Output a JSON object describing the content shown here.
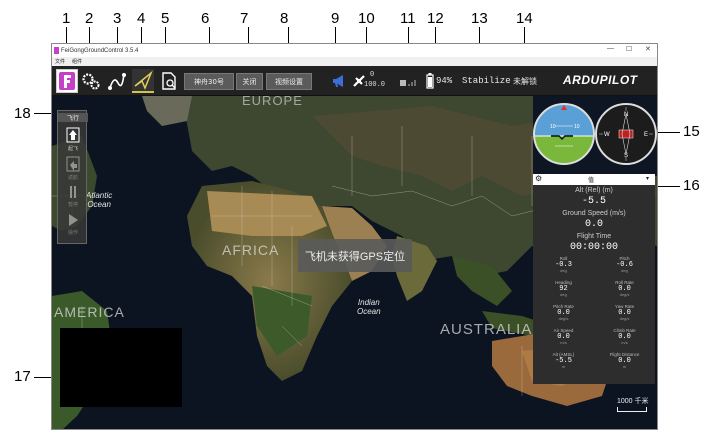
{
  "window": {
    "title": "FeiGongGroundControl 3.5.4",
    "controls": [
      "—",
      "☐",
      "✕"
    ]
  },
  "menu": [
    "文件",
    "组件"
  ],
  "toolbar": {
    "buttons": [
      "神舟30号",
      "关闭",
      "视频设置"
    ],
    "link_value": "0",
    "link_value2": "100.0",
    "battery": "94%",
    "mode": "Stabilize",
    "arm_status": "未解锁",
    "logo_text": "ARDUPILOT"
  },
  "map": {
    "labels": {
      "europe": "EUROPE",
      "atlantic": "Atlantic\nOcean",
      "africa": "AFRICA",
      "indian": "Indian\nOcean",
      "america": "AMERICA",
      "australia": "AUSTRALIA"
    },
    "gps_message": "飞机未获得GPS定位",
    "scale": "1000 千米"
  },
  "left_panel": {
    "title": "飞行",
    "items": [
      "起飞",
      "返航",
      "暂停",
      "操作"
    ]
  },
  "attitude_scale": [
    "10",
    "10"
  ],
  "compass_letters": [
    "N",
    "E",
    "S",
    "W"
  ],
  "values": {
    "dropdown": "值",
    "alt_rel_label": "Alt (Rel) (m)",
    "alt_rel_value": "-5.5",
    "ground_speed_label": "Ground Speed (m/s)",
    "ground_speed_value": "0.0",
    "flight_time_label": "Flight Time",
    "flight_time_value": "00:00:00",
    "cells": [
      {
        "label": "Roll",
        "value": "-0.3",
        "unit": "deg"
      },
      {
        "label": "Pitch",
        "value": "-0.6",
        "unit": "deg"
      },
      {
        "label": "Heading",
        "value": "92",
        "unit": "deg"
      },
      {
        "label": "Roll Rate",
        "value": "0.0",
        "unit": "deg/s"
      },
      {
        "label": "Pitch Rate",
        "value": "0.0",
        "unit": "deg/s"
      },
      {
        "label": "Yaw Rate",
        "value": "0.0",
        "unit": "deg/s"
      },
      {
        "label": "Air Speed",
        "value": "0.0",
        "unit": "m/s"
      },
      {
        "label": "Climb Rate",
        "value": "0.0",
        "unit": "m/s"
      },
      {
        "label": "Alt (AMSL)",
        "value": "-5.5",
        "unit": "m"
      },
      {
        "label": "Flight Distance",
        "value": "0.0",
        "unit": "m"
      }
    ]
  },
  "callouts": [
    "1",
    "2",
    "3",
    "4",
    "5",
    "6",
    "7",
    "8",
    "9",
    "10",
    "11",
    "12",
    "13",
    "14",
    "15",
    "16",
    "17",
    "18"
  ],
  "colors": {
    "accent": "#c63fc9",
    "sky": "#5aa0d6",
    "ground": "#7ab83c",
    "map_bg": "#0b1420"
  }
}
